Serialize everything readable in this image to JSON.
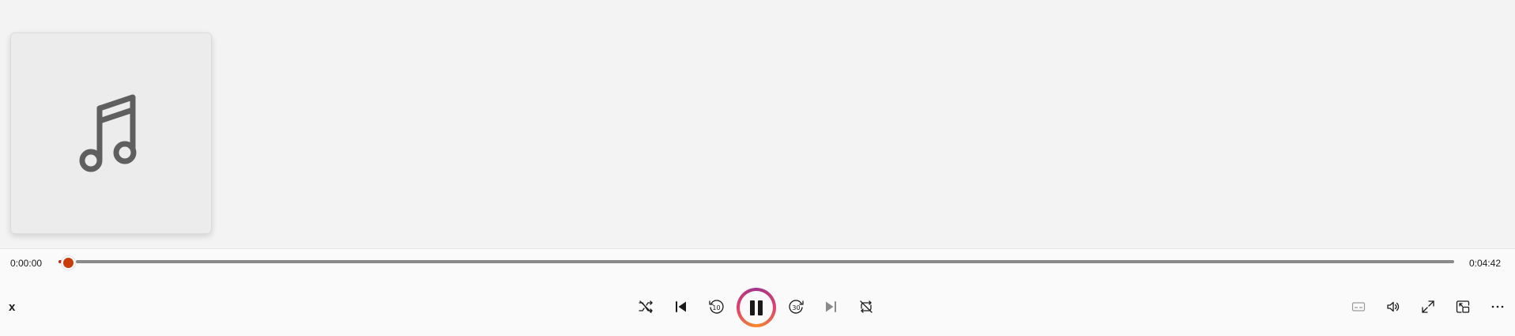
{
  "player": {
    "current_time": "0:00:00",
    "total_time": "0:04:42",
    "progress": 0.0,
    "close_label": "x",
    "accent_color": "#c83c0a",
    "play_state": "playing"
  },
  "transport": {
    "items": [
      {
        "name": "shuffle-icon"
      },
      {
        "name": "previous-icon"
      },
      {
        "name": "skip-back-10-icon",
        "label": "10"
      },
      {
        "name": "pause-icon"
      },
      {
        "name": "skip-forward-30-icon",
        "label": "30"
      },
      {
        "name": "next-icon"
      },
      {
        "name": "repeat-icon"
      }
    ]
  },
  "right_controls": {
    "items": [
      {
        "name": "captions-icon"
      },
      {
        "name": "volume-icon"
      },
      {
        "name": "fullscreen-icon"
      },
      {
        "name": "mini-player-icon"
      },
      {
        "name": "more-options-icon"
      }
    ]
  },
  "album_art": {
    "icon": "music-note-icon"
  }
}
